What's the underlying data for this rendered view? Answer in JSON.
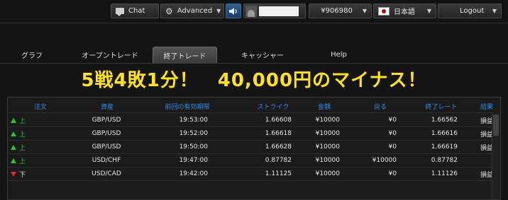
{
  "topbar": {
    "chat_label": "Chat",
    "mode_label": "Advanced",
    "balance": "¥906980",
    "language": "日本語",
    "logout_label": "Logout"
  },
  "tabs": [
    "グラフ",
    "オープントレード",
    "終了トレード",
    "キャッシャー",
    "Help"
  ],
  "active_tab": "終了トレード",
  "headline": "5戦4敗1分！　40,000円のマイナス！",
  "table": {
    "columns": [
      "注文",
      "資産",
      "前回の有効期限",
      "ストライク",
      "金額",
      "戻る",
      "終了レート",
      "結果"
    ],
    "rows": [
      {
        "direction": "up",
        "dir_label": "上",
        "asset": "GBP/USD",
        "expiry": "19:53:00",
        "strike": "1.66608",
        "amount": "¥10000",
        "returned": "¥0",
        "close_rate": "1.66562",
        "result": "損益"
      },
      {
        "direction": "up",
        "dir_label": "上",
        "asset": "GBP/USD",
        "expiry": "19:52:00",
        "strike": "1.66618",
        "amount": "¥10000",
        "returned": "¥0",
        "close_rate": "1.66616",
        "result": "損益"
      },
      {
        "direction": "up",
        "dir_label": "上",
        "asset": "GBP/USD",
        "expiry": "19:50:00",
        "strike": "1.66628",
        "amount": "¥10000",
        "returned": "¥0",
        "close_rate": "1.66619",
        "result": "損益"
      },
      {
        "direction": "up",
        "dir_label": "上",
        "asset": "USD/CHF",
        "expiry": "19:47:00",
        "strike": "0.87782",
        "amount": "¥10000",
        "returned": "¥10000",
        "close_rate": "0.87782",
        "result": ""
      },
      {
        "direction": "down",
        "dir_label": "下",
        "asset": "USD/CAD",
        "expiry": "19:42:00",
        "strike": "1.11125",
        "amount": "¥10000",
        "returned": "¥0",
        "close_rate": "1.11126",
        "result": "損益"
      }
    ]
  },
  "colors": {
    "accent_blue": "#2f8fe6",
    "headline_yellow": "#ffe414",
    "up_green": "#28c828",
    "down_red": "#e22222"
  }
}
